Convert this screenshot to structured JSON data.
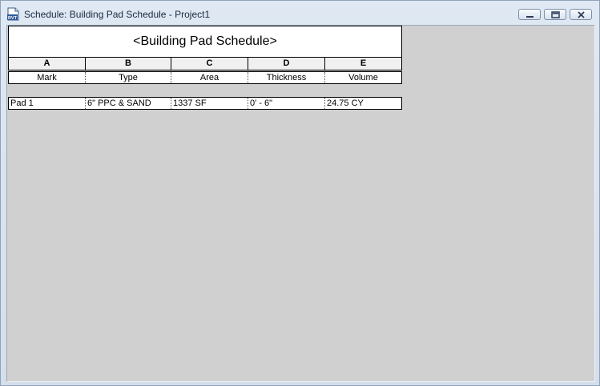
{
  "window": {
    "title": "Schedule: Building Pad Schedule - Project1",
    "icon": "rvt-document-icon"
  },
  "schedule": {
    "title": "<Building Pad Schedule>",
    "column_letters": [
      "A",
      "B",
      "C",
      "D",
      "E"
    ],
    "columns": [
      "Mark",
      "Type",
      "Area",
      "Thickness",
      "Volume"
    ],
    "rows": [
      [
        "Pad 1",
        "6\" PPC & SAND",
        "1337 SF",
        "0' - 6\"",
        "24.75 CY"
      ]
    ]
  },
  "colors": {
    "client_background": "#d0d0d0",
    "header_background": "#f0f0f0",
    "window_chrome": "#d4dfec"
  }
}
